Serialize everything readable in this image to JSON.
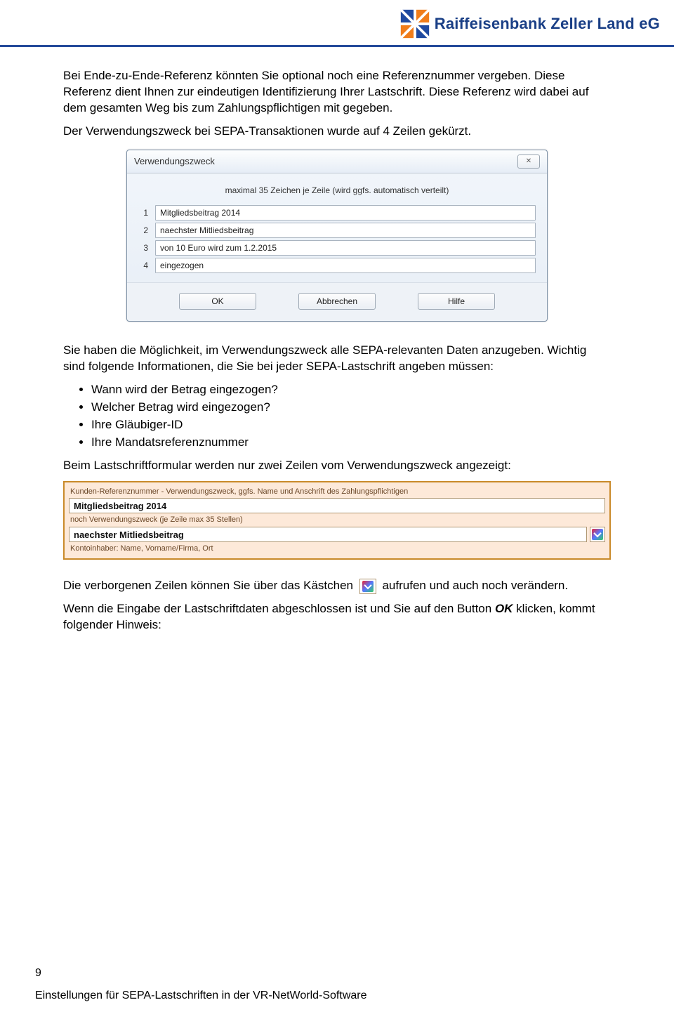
{
  "header": {
    "bank_name": "Raiffeisenbank Zeller Land eG"
  },
  "intro": {
    "p1": "Bei Ende-zu-Ende-Referenz könnten Sie optional noch eine Referenznummer vergeben. Diese Referenz dient Ihnen zur eindeutigen Identifizierung Ihrer Lastschrift. Diese Referenz wird dabei auf dem gesamten Weg bis zum Zahlungspflichtigen mit gegeben.",
    "p2": "Der Verwendungszweck bei SEPA-Transaktionen wurde auf 4 Zeilen gekürzt."
  },
  "dialog": {
    "title": "Verwendungszweck",
    "close_hint": "✕",
    "hint": "maximal 35 Zeichen je Zeile (wird ggfs. automatisch verteilt)",
    "rows": [
      {
        "num": "1",
        "value": "Mitgliedsbeitrag 2014"
      },
      {
        "num": "2",
        "value": "naechster Mitliedsbeitrag"
      },
      {
        "num": "3",
        "value": "von 10 Euro wird zum 1.2.2015"
      },
      {
        "num": "4",
        "value": "eingezogen"
      }
    ],
    "ok": "OK",
    "cancel": "Abbrechen",
    "help": "Hilfe"
  },
  "mid": {
    "p3": "Sie haben die Möglichkeit, im Verwendungszweck alle SEPA-relevanten Daten anzugeben. Wichtig sind folgende Informationen, die Sie bei jeder SEPA-Lastschrift angeben müssen:",
    "bullets": [
      "Wann wird der Betrag eingezogen?",
      "Welcher Betrag wird eingezogen?",
      "Ihre Gläubiger-ID",
      "Ihre Mandatsreferenznummer"
    ],
    "p4": "Beim Lastschriftformular werden nur zwei Zeilen vom Verwendungszweck angezeigt:"
  },
  "form2": {
    "label1": "Kunden-Referenznummer - Verwendungszweck, ggfs. Name und Anschrift des Zahlungspflichtigen",
    "value1": "Mitgliedsbeitrag 2014",
    "label2": "noch Verwendungszweck (je Zeile max 35 Stellen)",
    "value2": "naechster Mitliedsbeitrag",
    "label3": "Kontoinhaber: Name, Vorname/Firma, Ort"
  },
  "tail": {
    "p5a": "Die verborgenen Zeilen können Sie über das Kästchen",
    "p5b": "aufrufen und auch noch verändern.",
    "p6a": "Wenn die Eingabe der Lastschriftdaten abgeschlossen ist und Sie auf den Button ",
    "ok": "OK",
    "p6b": " klicken, kommt folgender Hinweis:"
  },
  "footer": {
    "page_num": "9",
    "text": "Einstellungen für SEPA-Lastschriften in der VR-NetWorld-Software"
  }
}
